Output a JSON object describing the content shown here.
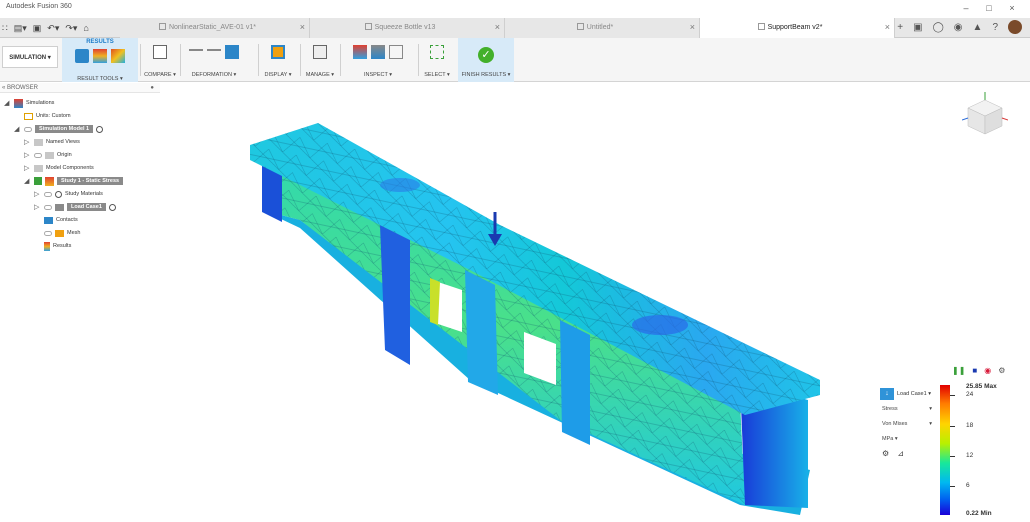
{
  "app": {
    "title": "Autodesk Fusion 360"
  },
  "tabs": [
    {
      "label": "NonlinearStatic_AVE-01 v1*"
    },
    {
      "label": "Squeeze Bottle v13"
    },
    {
      "label": "Untitled*"
    },
    {
      "label": "SupportBeam v2*"
    }
  ],
  "toolbar": {
    "workspace": "SIMULATION ▾",
    "results_tab": "RESULTS",
    "groups": {
      "result_tools": "RESULT TOOLS ▾",
      "compare": "COMPARE ▾",
      "deformation": "DEFORMATION ▾",
      "display": "DISPLAY ▾",
      "manage": "MANAGE ▾",
      "inspect": "INSPECT ▾",
      "select": "SELECT ▾",
      "finish": "FINISH RESULTS ▾"
    }
  },
  "browser": {
    "header": "BROWSER",
    "items": {
      "simulations": "Simulations",
      "units": "Units: Custom",
      "sim_model": "Simulation Model 1",
      "named_views": "Named Views",
      "origin": "Origin",
      "model_components": "Model Components",
      "study": "Study 1 - Static Stress",
      "study_materials": "Study Materials",
      "load_case": "Load Case1",
      "contacts": "Contacts",
      "mesh": "Mesh",
      "results": "Results"
    }
  },
  "legend": {
    "load_case": "Load Case1 ▾",
    "result_type": "Stress",
    "component": "Von Mises",
    "units": "MPa ▾",
    "max_label": "25.85 Max",
    "min_label": "0.22 Min",
    "ticks": [
      "24",
      "18",
      "12",
      "6"
    ],
    "max_value": 25.85,
    "min_value": 0.22
  }
}
